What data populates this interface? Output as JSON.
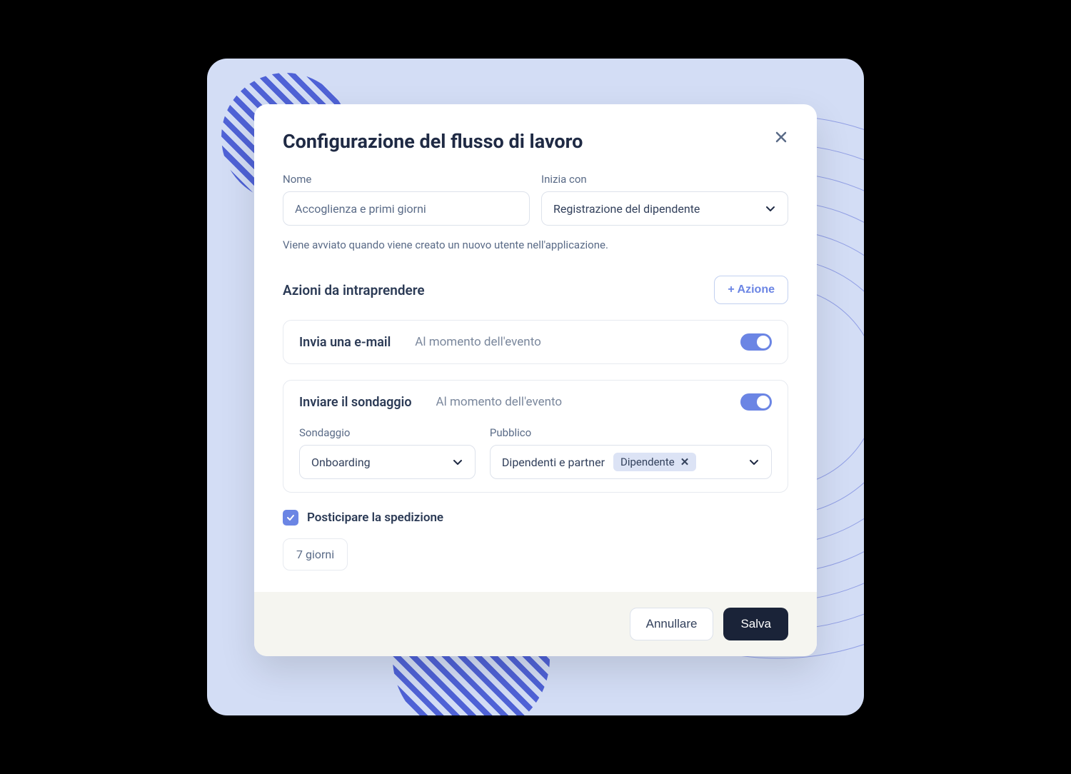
{
  "modal": {
    "title": "Configurazione del flusso di lavoro",
    "name_label": "Nome",
    "name_value": "Accoglienza e primi giorni",
    "starts_label": "Inizia con",
    "starts_value": "Registrazione del dipendente",
    "helper": "Viene avviato quando viene creato un nuovo utente nell'applicazione.",
    "actions_title": "Azioni da intraprendere",
    "add_action": "+ Azione",
    "actions": [
      {
        "name": "Invia una e-mail",
        "timing": "Al momento dell'evento",
        "enabled": true
      },
      {
        "name": "Inviare il sondaggio",
        "timing": "Al momento dell'evento",
        "enabled": true,
        "survey_label": "Sondaggio",
        "survey_value": "Onboarding",
        "audience_label": "Pubblico",
        "audience_text": "Dipendenti e partner",
        "audience_chip": "Dipendente"
      }
    ],
    "postpone_label": "Posticipare la spedizione",
    "delay_value": "7 giorni",
    "cancel": "Annullare",
    "save": "Salva"
  }
}
